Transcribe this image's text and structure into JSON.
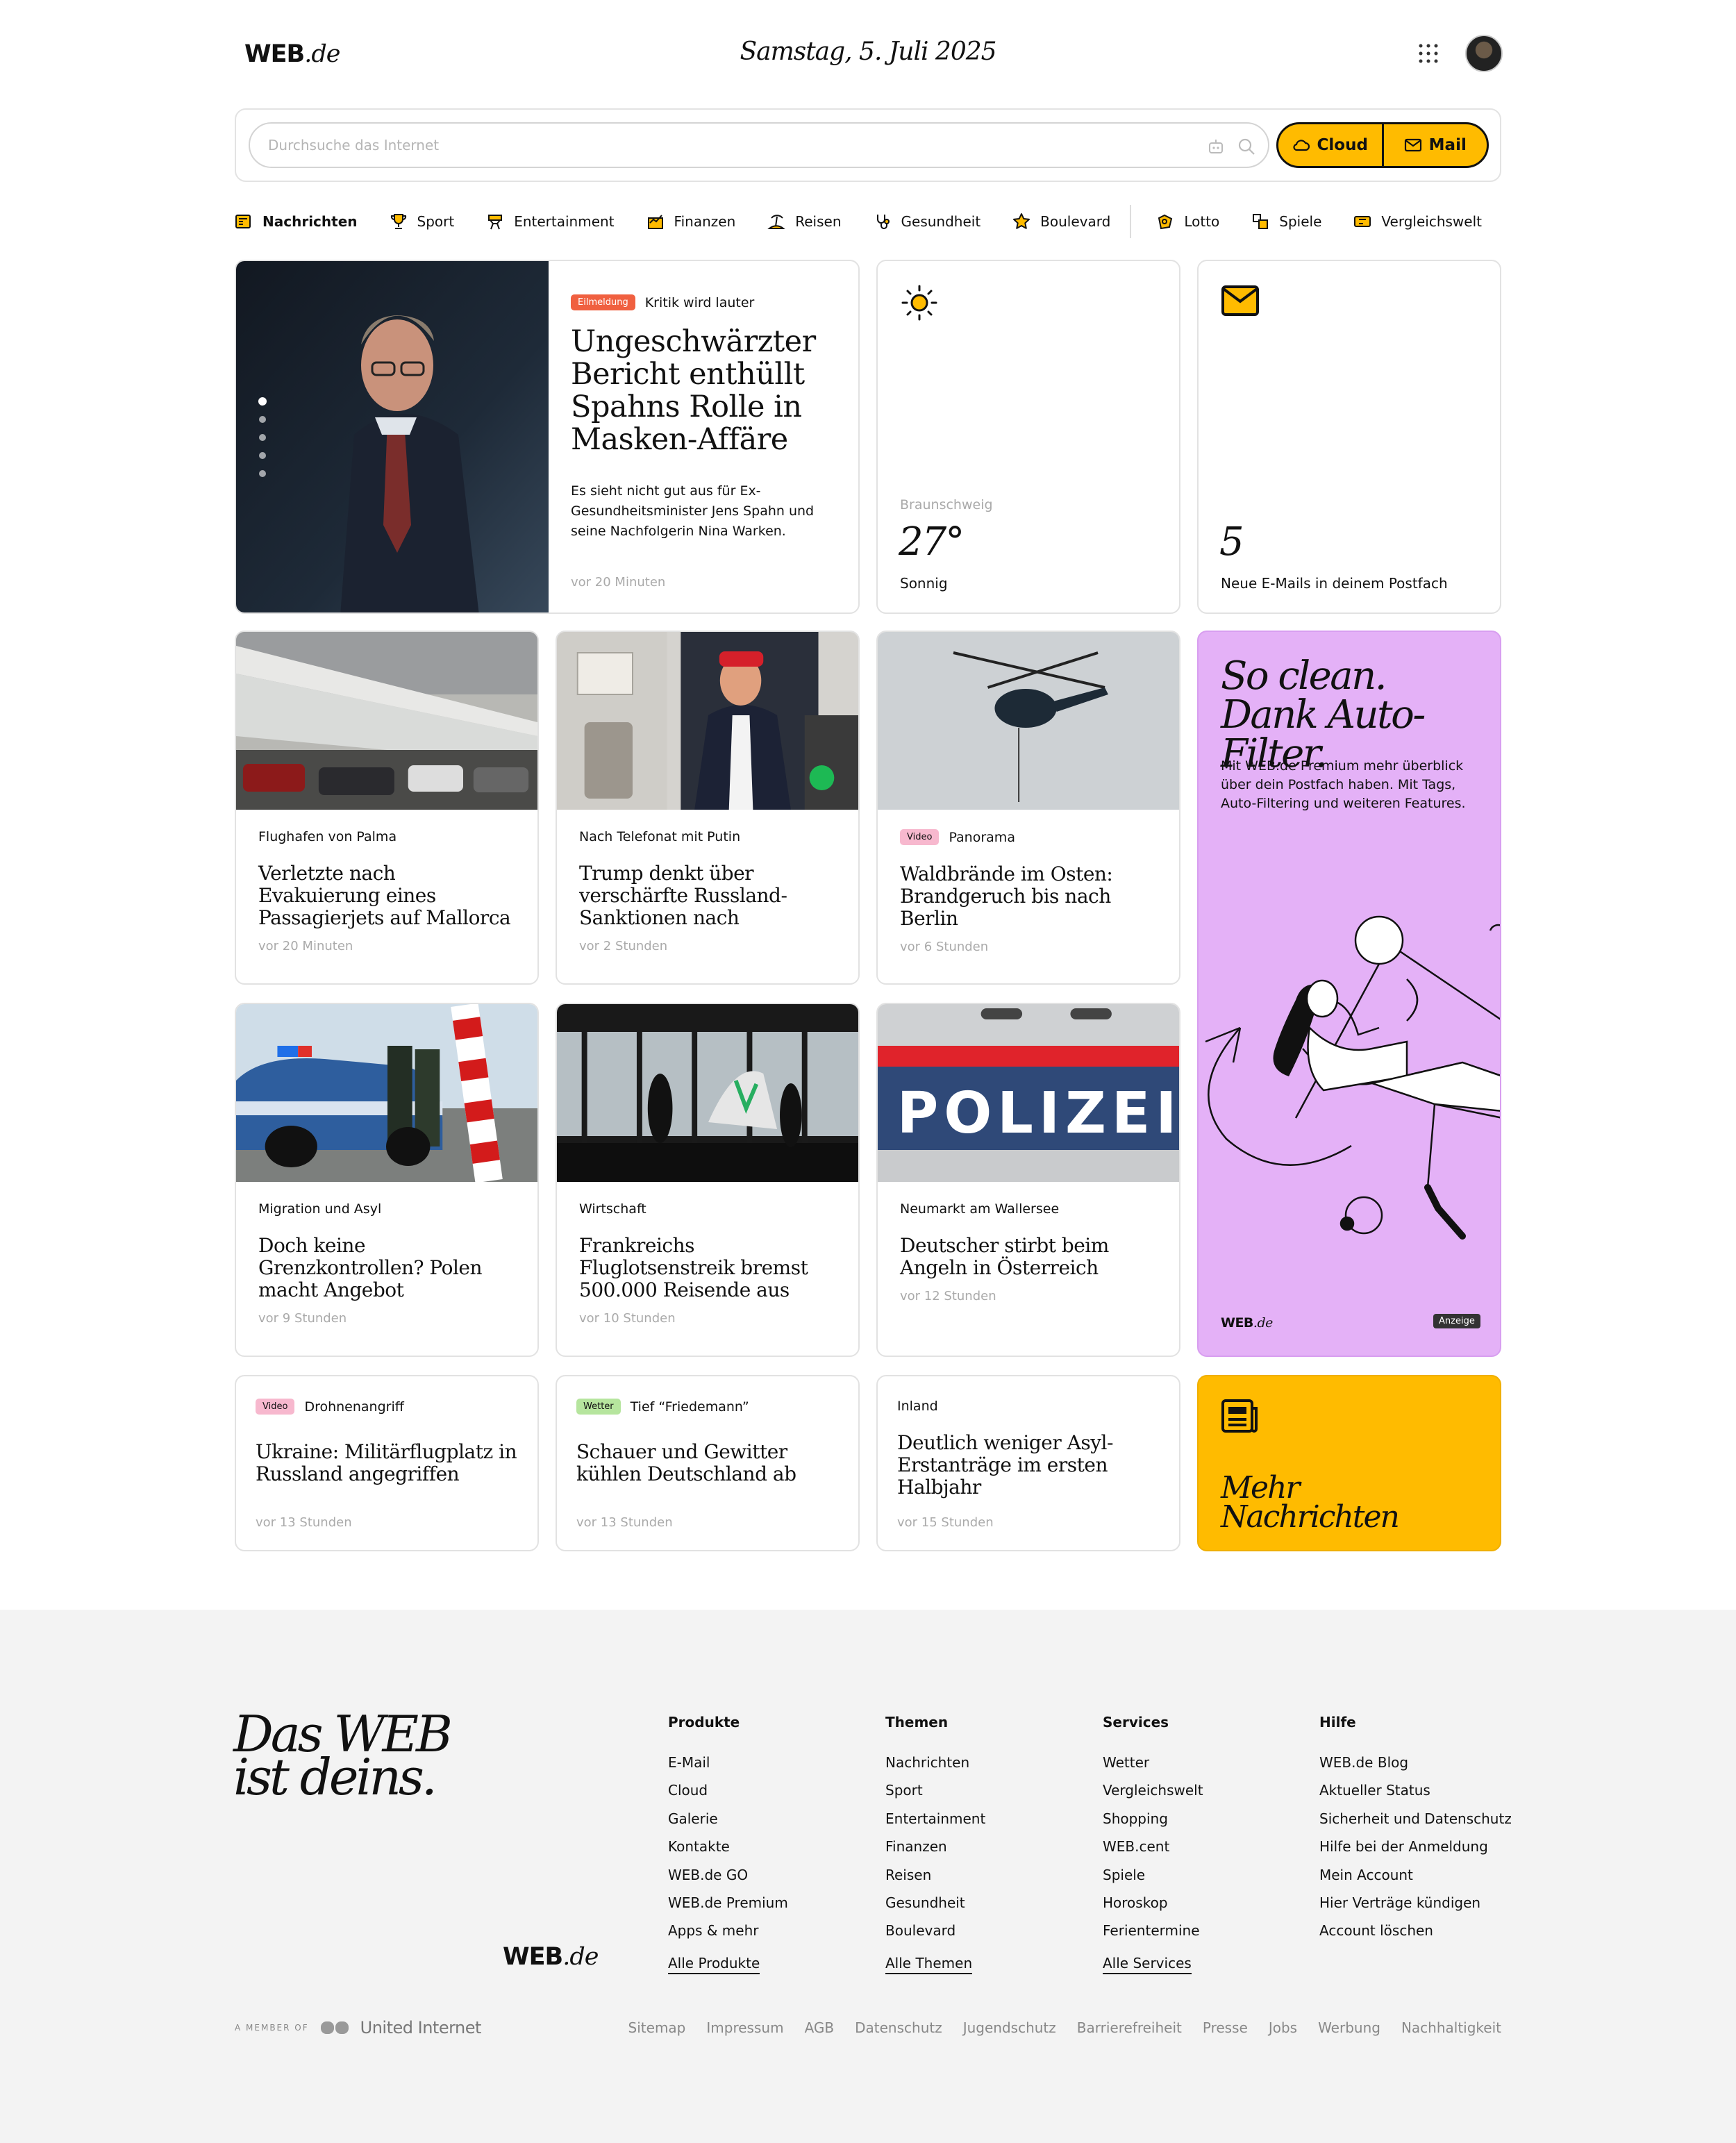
{
  "header": {
    "logo_bold": "WEB",
    "logo_light": ".de",
    "date": "Samstag, 5. Juli 2025"
  },
  "search": {
    "placeholder": "Durchsuche das Internet",
    "cloud_label": "Cloud",
    "mail_label": "Mail",
    "accent": "#ffbb00"
  },
  "nav": {
    "items": [
      {
        "label": "Nachrichten",
        "icon": "newspaper-icon"
      },
      {
        "label": "Sport",
        "icon": "trophy-icon"
      },
      {
        "label": "Entertainment",
        "icon": "clapperboard-icon"
      },
      {
        "label": "Finanzen",
        "icon": "chart-icon"
      },
      {
        "label": "Reisen",
        "icon": "beach-icon"
      },
      {
        "label": "Gesundheit",
        "icon": "stethoscope-icon"
      },
      {
        "label": "Boulevard",
        "icon": "star-icon"
      },
      {
        "label": "Lotto",
        "icon": "clover-icon"
      },
      {
        "label": "Spiele",
        "icon": "puzzle-icon"
      },
      {
        "label": "Vergleichswelt",
        "icon": "ticket-icon"
      }
    ]
  },
  "hero": {
    "badge": "Eilmeldung",
    "kicker": "Kritik wird lauter",
    "title": "Ungeschwärzter Bericht enthüllt Spahns Rolle in Masken-Affäre",
    "teaser": "Es sieht nicht gut aus für Ex-Gesundheitsminister Jens Spahn und seine Nachfolgerin Nina Warken.",
    "time": "vor 20 Minuten"
  },
  "weather": {
    "icon": "sun-icon",
    "city": "Braunschweig",
    "temp": "27°",
    "condition": "Sonnig"
  },
  "mail": {
    "icon": "envelope-icon",
    "count": "5",
    "text": "Neue E-Mails in deinem Postfach"
  },
  "articles": [
    {
      "kicker": "Flughafen von Palma",
      "title": "Verletzte nach Evakuierung eines Passagierjets auf Mallorca",
      "time": "vor 20 Minuten"
    },
    {
      "kicker": "Nach Telefonat mit Putin",
      "title": "Trump denkt über verschärfte Russland-Sanktionen nach",
      "time": "vor 2 Stunden"
    },
    {
      "badge": "Video",
      "kicker": "Panorama",
      "title": "Waldbrände im Osten: Brandgeruch bis nach Berlin",
      "time": "vor 6 Stunden"
    },
    {
      "kicker": "Migration und Asyl",
      "title": "Doch keine Grenzkontrollen? Polen macht Angebot",
      "time": "vor 9 Stunden"
    },
    {
      "kicker": "Wirtschaft",
      "title": "Frankreichs Fluglotsenstreik bremst 500.000 Reisende aus",
      "time": "vor 10 Stunden"
    },
    {
      "kicker": "Neumarkt am Wallersee",
      "title": "Deutscher stirbt beim Angeln in Österreich",
      "time": "vor 12 Stunden"
    }
  ],
  "small_articles": [
    {
      "badge": "Video",
      "kicker": "Drohnenangriff",
      "title": "Ukraine: Militärflugplatz in Russland angegriffen",
      "time": "vor 13 Stunden"
    },
    {
      "badge": "Wetter",
      "kicker": "Tief “Friedemann”",
      "title": "Schauer und Gewitter kühlen Deutschland ab",
      "time": "vor 13 Stunden"
    },
    {
      "kicker": "Inland",
      "title": "Deutlich weniger Asyl-Erstanträge im ersten Halbjahr",
      "time": "vor 15 Stunden"
    }
  ],
  "ad": {
    "headline": "So clean. Dank Auto-Filter.",
    "text": "Mit WEB.de Premium mehr überblick über dein Postfach haben. Mit Tags, Auto-Filtering und weiteren Features.",
    "logo_bold": "WEB",
    "logo_light": ".de",
    "label": "Anzeige",
    "bg": "#e4b1f7"
  },
  "more": {
    "icon": "newspaper-icon",
    "label": "Mehr Nachrichten",
    "bg": "#ffbb00"
  },
  "footer": {
    "slogan_1": "Das WEB",
    "slogan_2": "ist deins.",
    "logo_bold": "WEB",
    "logo_light": ".de",
    "columns": [
      {
        "title": "Produkte",
        "items": [
          "E-Mail",
          "Cloud",
          "Galerie",
          "Kontakte",
          "WEB.de GO",
          "WEB.de Premium",
          "Apps & mehr"
        ],
        "all": "Alle Produkte"
      },
      {
        "title": "Themen",
        "items": [
          "Nachrichten",
          "Sport",
          "Entertainment",
          "Finanzen",
          "Reisen",
          "Gesundheit",
          "Boulevard"
        ],
        "all": "Alle Themen"
      },
      {
        "title": "Services",
        "items": [
          "Wetter",
          "Vergleichswelt",
          "Shopping",
          "WEB.cent",
          "Spiele",
          "Horoskop",
          "Ferientermine"
        ],
        "all": "Alle Services"
      },
      {
        "title": "Hilfe",
        "items": [
          "WEB.de Blog",
          "Aktueller Status",
          "Sicherheit und Datenschutz",
          "Hilfe bei der Anmeldung",
          "Mein Account",
          "Hier Verträge kündigen",
          "Account löschen"
        ],
        "all": ""
      }
    ],
    "member_text": "A MEMBER OF",
    "member_brand": "United Internet",
    "links": [
      "Sitemap",
      "Impressum",
      "AGB",
      "Datenschutz",
      "Jugendschutz",
      "Barrierefreiheit",
      "Presse",
      "Jobs",
      "Werbung",
      "Nachhaltigkeit"
    ]
  }
}
